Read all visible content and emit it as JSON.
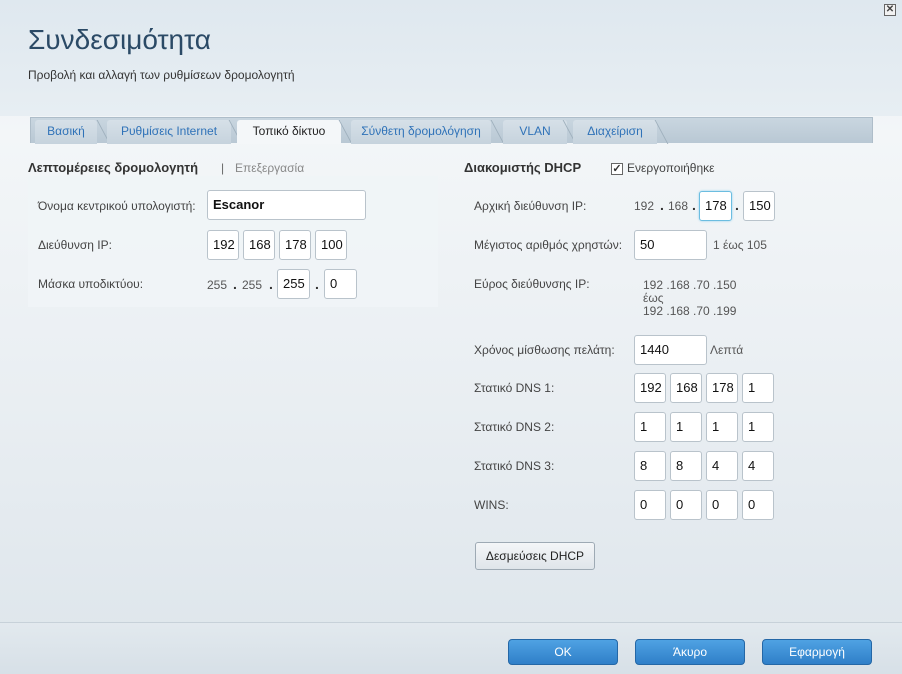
{
  "window": {
    "close_glyph": "✕"
  },
  "header": {
    "title": "Συνδεσιμότητα",
    "subtitle": "Προβολή και αλλαγή των ρυθμίσεων δρομολογητή"
  },
  "tabs": [
    {
      "label": "Βασική"
    },
    {
      "label": "Ρυθμίσεις Internet"
    },
    {
      "label": "Τοπικό δίκτυο",
      "active": true
    },
    {
      "label": "Σύνθετη δρομολόγηση"
    },
    {
      "label": "VLAN"
    },
    {
      "label": "Διαχείριση"
    }
  ],
  "router_details": {
    "title": "Λεπτομέρειες δρομολογητή",
    "separator": "|",
    "edit_label": "Επεξεργασία",
    "hostname_label": "Όνομα κεντρικού υπολογιστή:",
    "hostname_value": "Escanor",
    "ip_label": "Διεύθυνση IP:",
    "ip": [
      "192",
      "168",
      "178",
      "100"
    ],
    "mask_label": "Μάσκα υποδικτύου:",
    "mask_static": [
      "255",
      "255"
    ],
    "mask_fields": [
      "255",
      "0"
    ]
  },
  "dhcp": {
    "title": "Διακομιστής DHCP",
    "enabled_label": "Ενεργοποιήθηκε",
    "enabled_glyph": "✓",
    "start_ip_label": "Αρχική διεύθυνση IP:",
    "start_ip_static": [
      "192",
      "168"
    ],
    "start_ip_fields": [
      "178",
      "150"
    ],
    "max_users_label": "Μέγιστος αριθμός χρηστών:",
    "max_users_value": "50",
    "max_users_range": "1 έως 105",
    "range_label": "Εύρος διεύθυνσης IP:",
    "range_from": "192 .168 .70 .150",
    "range_to_word": "έως",
    "range_to": "192 .168 .70 .199",
    "lease_label": "Χρόνος μίσθωσης πελάτη:",
    "lease_value": "1440",
    "lease_unit": "Λεπτά",
    "dns1_label": "Στατικό DNS 1:",
    "dns1": [
      "192",
      "168",
      "178",
      "1"
    ],
    "dns2_label": "Στατικό DNS 2:",
    "dns2": [
      "1",
      "1",
      "1",
      "1"
    ],
    "dns3_label": "Στατικό DNS 3:",
    "dns3": [
      "8",
      "8",
      "4",
      "4"
    ],
    "wins_label": "WINS:",
    "wins": [
      "0",
      "0",
      "0",
      "0"
    ],
    "reservations_button": "Δεσμεύσεις DHCP",
    "dot": "."
  },
  "footer": {
    "ok": "OK",
    "cancel": "Άκυρο",
    "apply": "Εφαρμογή"
  },
  "colors": {
    "accent": "#2f72b8",
    "title": "#2b4a66",
    "button_blue": "#3a8bd4"
  }
}
